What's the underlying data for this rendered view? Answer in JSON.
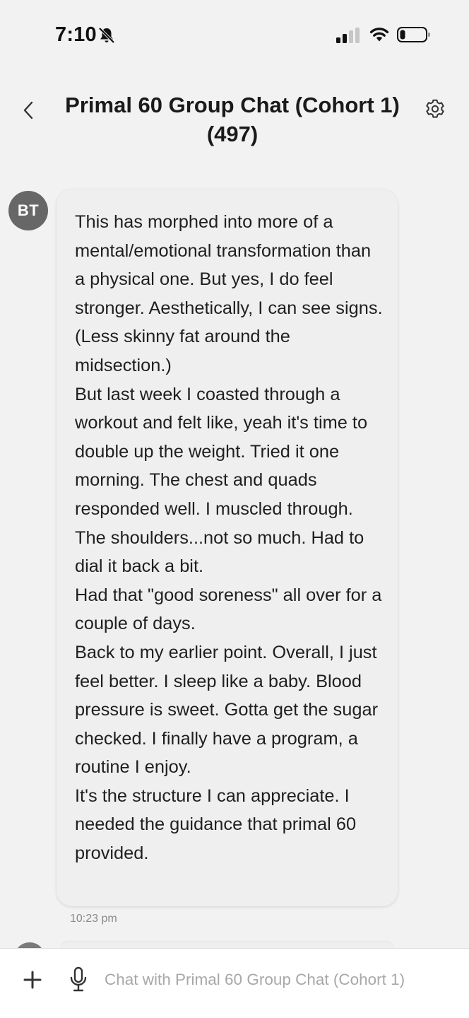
{
  "status_bar": {
    "time": "7:10",
    "icons": [
      "bell-slash-icon",
      "signal-icon",
      "wifi-icon",
      "battery-icon"
    ]
  },
  "header": {
    "title": "Primal 60 Group Chat (Cohort 1) (497)",
    "icons": [
      "chevron-left-icon",
      "gear-icon"
    ]
  },
  "message": {
    "avatar_initials": "BT",
    "text": "This has morphed into more of a mental/emotional transformation than a physical one. But yes, I do feel stronger. Aesthetically, I can see signs. (Less skinny fat around the midsection.)\nBut last week I coasted through a workout and felt like, yeah it's time to double up the weight. Tried it one morning. The chest and quads responded well. I muscled through.\nThe shoulders...not so much. Had to dial it back a bit.\nHad that \"good soreness\" all over for a couple of days.\nBack to my earlier point. Overall, I just feel better. I sleep like a baby. Blood pressure is sweet. Gotta get the sugar checked. I finally have a program, a routine I enjoy.\nIt's the structure I can appreciate. I needed the guidance that primal 60 provided.",
    "time": "10:23 pm"
  },
  "composer": {
    "placeholder": "Chat with Primal 60 Group Chat (Cohort 1)",
    "value": "",
    "icons": [
      "plus-icon",
      "microphone-icon"
    ]
  },
  "colors": {
    "background": "#f2f2f2",
    "bubble": "#efefef",
    "avatar": "#676767",
    "placeholder": "#a8a8a8"
  }
}
